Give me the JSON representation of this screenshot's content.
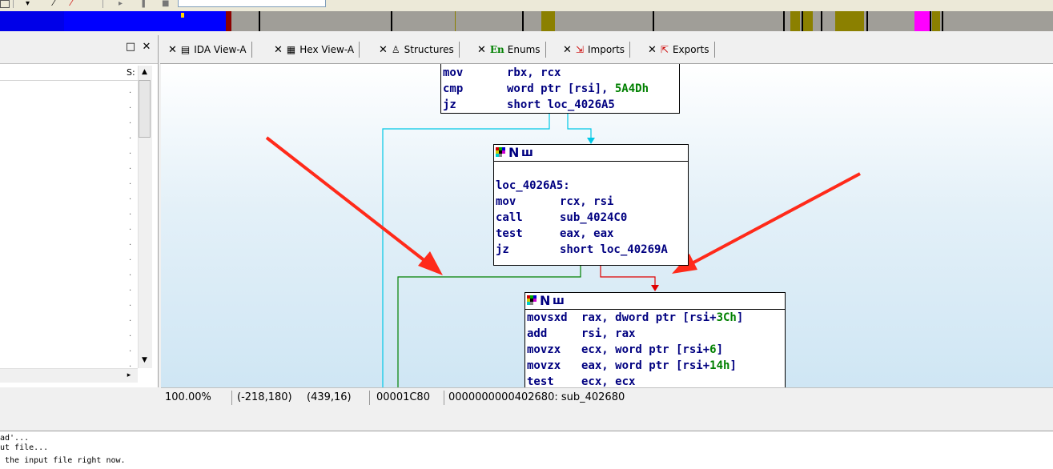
{
  "tabs": [
    {
      "label": "IDA View-A",
      "icon": "ida-view-icon"
    },
    {
      "label": "Hex View-A",
      "icon": "hex-view-icon"
    },
    {
      "label": "Structures",
      "icon": "structures-icon"
    },
    {
      "label": "Enums",
      "icon": "enums-icon",
      "icon_text": "En"
    },
    {
      "label": "Imports",
      "icon": "imports-icon"
    },
    {
      "label": "Exports",
      "icon": "exports-icon"
    }
  ],
  "function_pane": {
    "column_header": "S:"
  },
  "nodes": {
    "top": {
      "rows": [
        {
          "mn": "mov",
          "op": "rbx, rcx",
          "imm": ""
        },
        {
          "mn": "cmp",
          "op": "word ptr [rsi], ",
          "imm": "5A4Dh"
        },
        {
          "mn": "jz",
          "op": "short loc_4026A5",
          "imm": ""
        }
      ]
    },
    "mid": {
      "header_n": "N",
      "header_u": "ш",
      "label": "loc_4026A5:",
      "rows": [
        {
          "mn": "mov",
          "op": "rcx, rsi",
          "imm": ""
        },
        {
          "mn": "call",
          "op": "sub_4024C0",
          "imm": ""
        },
        {
          "mn": "test",
          "op": "eax, eax",
          "imm": ""
        },
        {
          "mn": "jz",
          "op": "short loc_40269A",
          "imm": ""
        }
      ]
    },
    "bottom": {
      "header_n": "N",
      "header_u": "ш",
      "rows": [
        {
          "mn": "movsxd",
          "op": "rax, dword ptr [rsi+",
          "imm": "3Ch",
          "tail": "]"
        },
        {
          "mn": "add",
          "op": "rsi, rax",
          "imm": "",
          "tail": ""
        },
        {
          "mn": "movzx",
          "op": "ecx, word ptr [rsi+",
          "imm": "6",
          "tail": "]"
        },
        {
          "mn": "movzx",
          "op": "eax, word ptr [rsi+",
          "imm": "14h",
          "tail": "]"
        },
        {
          "mn": "test",
          "op": "ecx, ecx",
          "imm": "",
          "tail": ""
        }
      ]
    }
  },
  "status": {
    "zoom": "100.00%",
    "coords1": "(-218,180)",
    "coords2": "(439,16)",
    "offset": "00001C80",
    "address": "0000000000402680: sub_402680"
  },
  "output_lines": [
    "ad'...",
    "ut file...",
    " the input file right now."
  ],
  "colors": {
    "edge_true": "#00c8e6",
    "edge_false": "#e00000",
    "edge_green": "#008000",
    "annotation_arrow": "#ff2a1a",
    "nav_blue": "#0000ff",
    "nav_olive": "#8b8000",
    "nav_magenta": "#ff00ff"
  }
}
